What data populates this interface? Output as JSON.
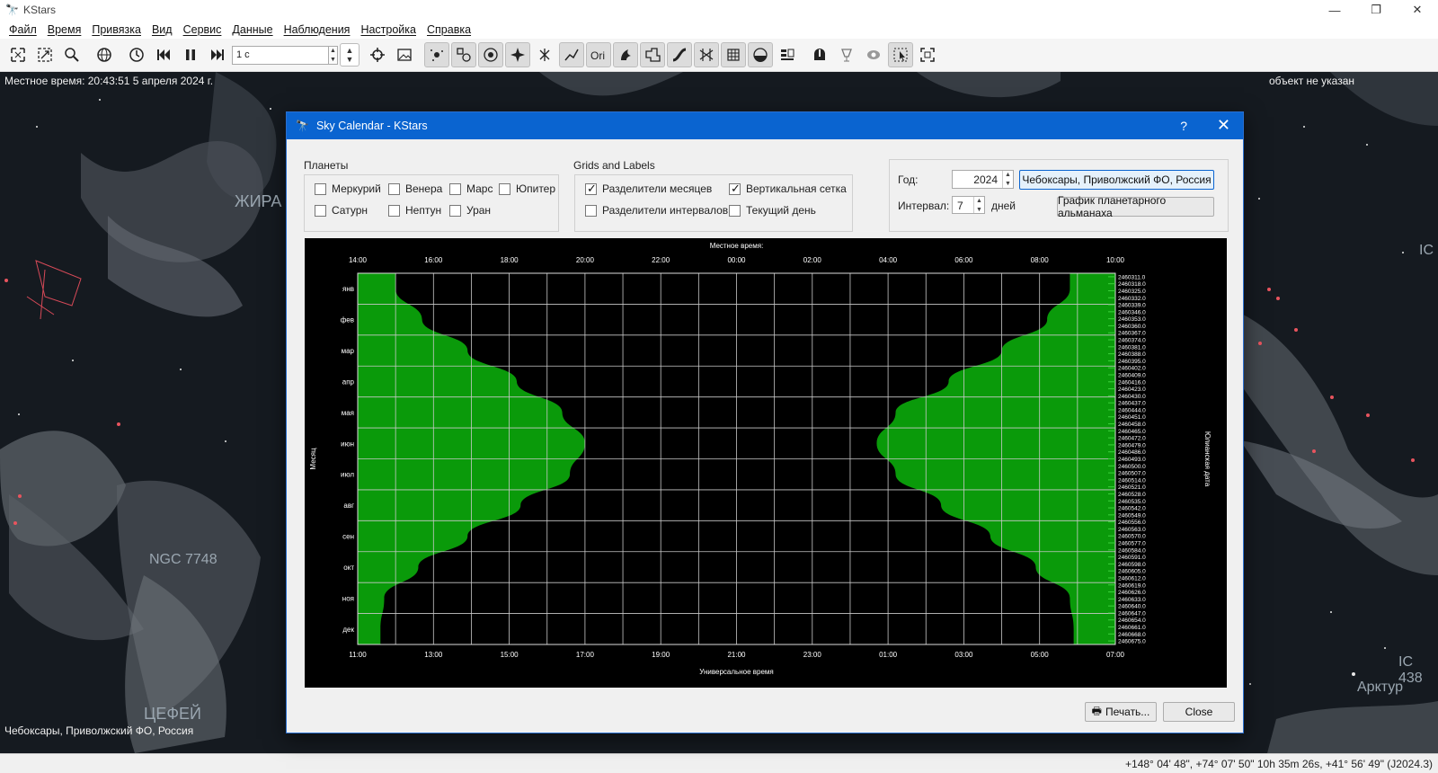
{
  "window": {
    "title": "KStars",
    "controls": [
      "—",
      "❐",
      "✕"
    ]
  },
  "menu": [
    "Файл",
    "Время",
    "Привязка",
    "Вид",
    "Сервис",
    "Данные",
    "Наблюдения",
    "Настройка",
    "Справка"
  ],
  "toolbar": {
    "time_step": "1 с"
  },
  "sky": {
    "local_time": "Местное время: 20:43:51   5 апреля 2024 г.",
    "object_status": "объект не указан",
    "location": "Чебоксары, Приволжский ФО, Россия",
    "labels": {
      "giraffe": "ЖИРА",
      "ngc": "NGC 7748",
      "cepheus": "ЦЕФЕЙ",
      "arcturus": "Арктур",
      "ic_right": "IC",
      "ic_bottom": "IC 438"
    }
  },
  "status_coords": "+148° 04' 48\", +74° 07' 50\"  10h 35m 26s, +41° 56' 49\" (J2024.3)",
  "dialog": {
    "title": "Sky Calendar - KStars",
    "help": "?",
    "close": "✕",
    "planets_group": "Планеты",
    "planets": [
      {
        "label": "Меркурий",
        "checked": false
      },
      {
        "label": "Венера",
        "checked": false
      },
      {
        "label": "Марс",
        "checked": false
      },
      {
        "label": "Юпитер",
        "checked": false
      },
      {
        "label": "Сатурн",
        "checked": false
      },
      {
        "label": "Нептун",
        "checked": false
      },
      {
        "label": "Уран",
        "checked": false
      }
    ],
    "grids_group": "Grids and Labels",
    "grids": [
      {
        "label": "Разделители месяцев",
        "checked": true
      },
      {
        "label": "Вертикальная сетка",
        "checked": true
      },
      {
        "label": "Разделители интервалов",
        "checked": false
      },
      {
        "label": "Текущий день",
        "checked": false
      }
    ],
    "year_label": "Год:",
    "year_value": "2024",
    "interval_label": "Интервал:",
    "interval_value": "7",
    "interval_unit": "дней",
    "location_button": "Чебоксары, Приволжский ФО, Россия",
    "plot_button": "График планетарного альманаха",
    "print_button": "Печать...",
    "close_button": "Close"
  },
  "chart_data": {
    "type": "area",
    "title_top": "Местное время:",
    "xlabel": "Универсальное время",
    "ylabel_left": "Месяц",
    "ylabel_right": "Юлианская дата",
    "local_time_ticks": [
      "14:00",
      "16:00",
      "18:00",
      "20:00",
      "22:00",
      "00:00",
      "02:00",
      "04:00",
      "06:00",
      "08:00",
      "10:00"
    ],
    "ut_ticks": [
      "11:00",
      "13:00",
      "15:00",
      "17:00",
      "19:00",
      "21:00",
      "23:00",
      "01:00",
      "03:00",
      "05:00",
      "07:00"
    ],
    "months": [
      "янв",
      "фев",
      "мар",
      "апр",
      "мая",
      "июн",
      "июл",
      "авг",
      "сен",
      "окт",
      "ноя",
      "дек"
    ],
    "jd_labels": [
      "2460311.0",
      "2460318.0",
      "2460325.0",
      "2460332.0",
      "2460339.0",
      "2460346.0",
      "2460353.0",
      "2460360.0",
      "2460367.0",
      "2460374.0",
      "2460381.0",
      "2460388.0",
      "2460395.0",
      "2460402.0",
      "2460409.0",
      "2460416.0",
      "2460423.0",
      "2460430.0",
      "2460437.0",
      "2460444.0",
      "2460451.0",
      "2460458.0",
      "2460465.0",
      "2460472.0",
      "2460479.0",
      "2460486.0",
      "2460493.0",
      "2460500.0",
      "2460507.0",
      "2460514.0",
      "2460521.0",
      "2460528.0",
      "2460535.0",
      "2460542.0",
      "2460549.0",
      "2460556.0",
      "2460563.0",
      "2460570.0",
      "2460577.0",
      "2460584.0",
      "2460591.0",
      "2460598.0",
      "2460605.0",
      "2460612.0",
      "2460619.0",
      "2460626.0",
      "2460633.0",
      "2460640.0",
      "2460647.0",
      "2460654.0",
      "2460661.0",
      "2460668.0",
      "2460675.0"
    ],
    "x_range_hours": [
      14,
      34
    ],
    "series": [
      {
        "name": "sunset",
        "color": "#0a9a0a",
        "hours": [
          15.0,
          15.7,
          16.9,
          18.2,
          19.4,
          20.0,
          19.6,
          18.3,
          16.9,
          15.6,
          14.7,
          14.6
        ]
      },
      {
        "name": "sunrise",
        "color": "#0a9a0a",
        "hours": [
          32.8,
          32.2,
          31.0,
          29.6,
          28.2,
          27.7,
          28.2,
          29.4,
          30.7,
          31.9,
          32.8,
          32.9
        ]
      }
    ]
  }
}
